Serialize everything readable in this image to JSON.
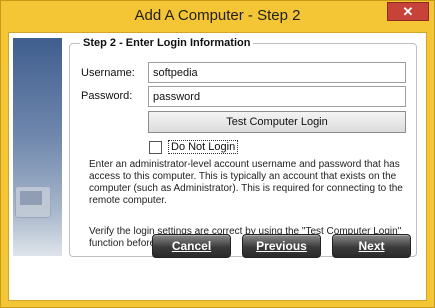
{
  "window": {
    "title": "Add A Computer - Step 2",
    "close_glyph": "✕"
  },
  "group": {
    "legend": "Step 2 - Enter Login Information"
  },
  "username": {
    "label": "Username:",
    "value": "softpedia"
  },
  "password": {
    "label": "Password:",
    "value": "password"
  },
  "test_button": {
    "label": "Test Computer Login"
  },
  "do_not_login": {
    "label": "Do Not Login",
    "checked": false
  },
  "help": {
    "paragraph1": "Enter an administrator-level account username and password that has access to this computer. This is typically an account that exists on the computer (such as Administrator). This is required for connecting to the remote computer.",
    "paragraph2": "Verify the login settings are correct by using the \"Test Computer Login\" function before proceeding."
  },
  "buttons": {
    "cancel": "Cancel",
    "previous": "Previous",
    "next": "Next"
  },
  "colors": {
    "frame": "#f4c534",
    "button_dark": "#2a2a2a"
  },
  "icons": {
    "close": "close-icon",
    "side_panel": "computer-graphic-icon"
  }
}
